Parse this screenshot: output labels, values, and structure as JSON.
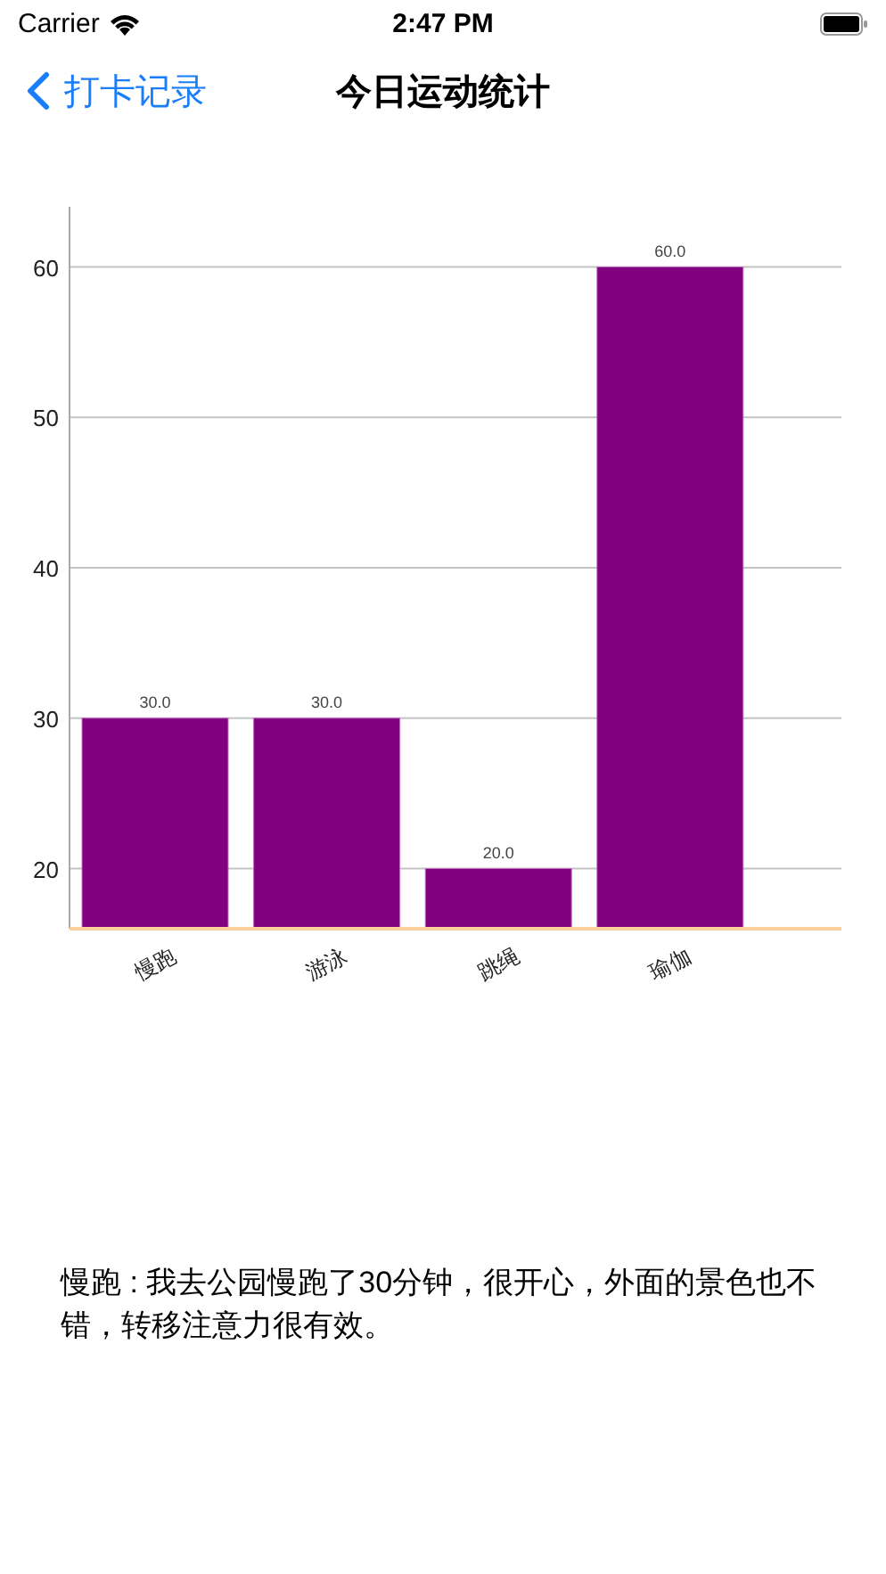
{
  "status_bar": {
    "carrier": "Carrier",
    "time": "2:47 PM"
  },
  "nav_bar": {
    "back": "打卡记录",
    "title": "今日运动统计"
  },
  "chart": {
    "chart_data": {
      "type": "bar",
      "categories": [
        "慢跑",
        "游泳",
        "跳绳",
        "瑜伽"
      ],
      "series": [
        {
          "color": "#800080",
          "values": [
            30,
            30,
            20,
            60
          ]
        }
      ],
      "ylim": [
        16,
        64
      ],
      "grid": true,
      "yticks": [
        20,
        30,
        40,
        50,
        60
      ],
      "value_labels": [
        "30.0",
        "30.0",
        "20.0",
        "60.0"
      ]
    }
  },
  "note": "慢跑 : 我去公园慢跑了30分钟，很开心，外面的景色也不错，转移注意力很有效。"
}
